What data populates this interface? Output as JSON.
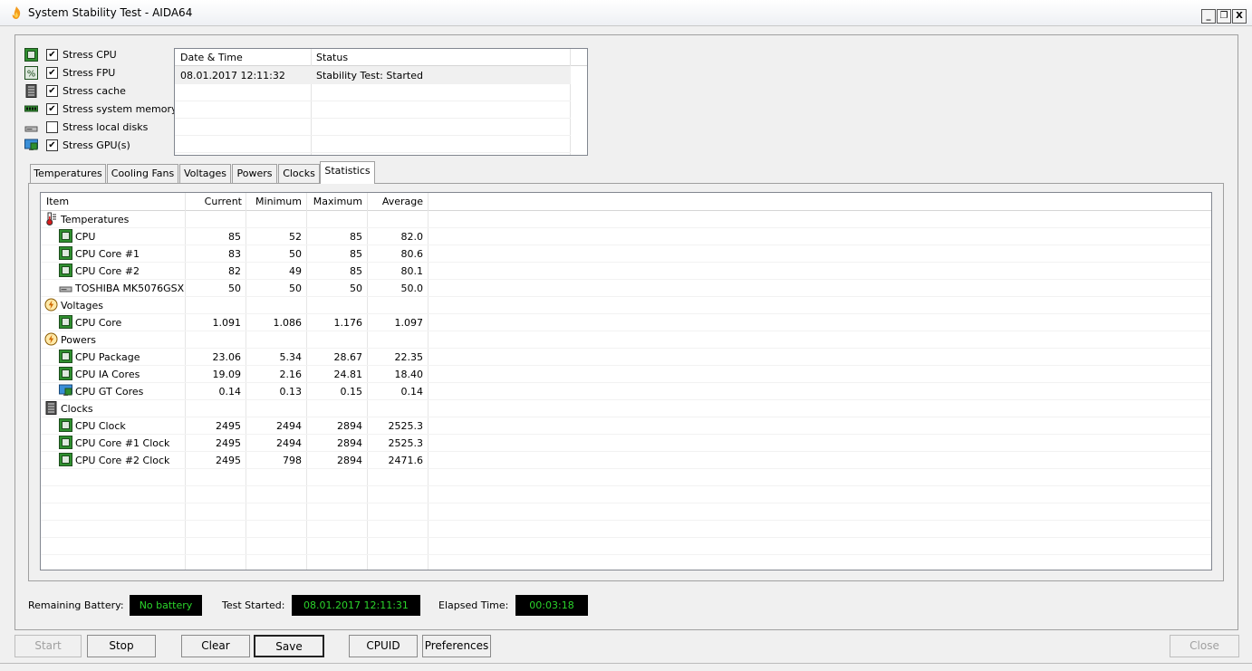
{
  "window": {
    "title": "System Stability Test - AIDA64",
    "min": "_",
    "restore": "❐",
    "close": "X"
  },
  "stress": [
    {
      "label": "Stress CPU",
      "checked": "✔",
      "icon": "cpu-chip-icon"
    },
    {
      "label": "Stress FPU",
      "checked": "✔",
      "icon": "fpu-percent-icon"
    },
    {
      "label": "Stress cache",
      "checked": "✔",
      "icon": "cache-chip-icon"
    },
    {
      "label": "Stress system memory",
      "checked": "✔",
      "icon": "memory-module-icon"
    },
    {
      "label": "Stress local disks",
      "checked": "",
      "icon": "disk-drive-icon"
    },
    {
      "label": "Stress GPU(s)",
      "checked": "✔",
      "icon": "gpu-monitor-icon"
    }
  ],
  "log": {
    "headers": [
      "Date & Time",
      "Status"
    ],
    "rows": [
      {
        "datetime": "08.01.2017 12:11:32",
        "status": "Stability Test: Started"
      }
    ]
  },
  "tabs": [
    "Temperatures",
    "Cooling Fans",
    "Voltages",
    "Powers",
    "Clocks",
    "Statistics"
  ],
  "active_tab": "Statistics",
  "stats": {
    "headers": {
      "item": "Item",
      "current": "Current",
      "minimum": "Minimum",
      "maximum": "Maximum",
      "average": "Average"
    },
    "rows": [
      {
        "group": true,
        "icon": "thermometer-icon",
        "item": "Temperatures"
      },
      {
        "icon": "cpu-chip-icon",
        "item": "CPU",
        "current": "85",
        "minimum": "52",
        "maximum": "85",
        "average": "82.0"
      },
      {
        "icon": "cpu-chip-icon",
        "item": "CPU Core #1",
        "current": "83",
        "minimum": "50",
        "maximum": "85",
        "average": "80.6"
      },
      {
        "icon": "cpu-chip-icon",
        "item": "CPU Core #2",
        "current": "82",
        "minimum": "49",
        "maximum": "85",
        "average": "80.1"
      },
      {
        "icon": "disk-drive-icon",
        "item": "TOSHIBA MK5076GSX",
        "current": "50",
        "minimum": "50",
        "maximum": "50",
        "average": "50.0"
      },
      {
        "group": true,
        "icon": "voltage-icon",
        "item": "Voltages"
      },
      {
        "icon": "cpu-chip-icon",
        "item": "CPU Core",
        "current": "1.091",
        "minimum": "1.086",
        "maximum": "1.176",
        "average": "1.097"
      },
      {
        "group": true,
        "icon": "power-icon",
        "item": "Powers"
      },
      {
        "icon": "cpu-chip-icon",
        "item": "CPU Package",
        "current": "23.06",
        "minimum": "5.34",
        "maximum": "28.67",
        "average": "22.35"
      },
      {
        "icon": "cpu-chip-icon",
        "item": "CPU IA Cores",
        "current": "19.09",
        "minimum": "2.16",
        "maximum": "24.81",
        "average": "18.40"
      },
      {
        "icon": "gpu-monitor-icon",
        "item": "CPU GT Cores",
        "current": "0.14",
        "minimum": "0.13",
        "maximum": "0.15",
        "average": "0.14"
      },
      {
        "group": true,
        "icon": "clock-chip-icon",
        "item": "Clocks"
      },
      {
        "icon": "cpu-chip-icon",
        "item": "CPU Clock",
        "current": "2495",
        "minimum": "2494",
        "maximum": "2894",
        "average": "2525.3"
      },
      {
        "icon": "cpu-chip-icon",
        "item": "CPU Core #1 Clock",
        "current": "2495",
        "minimum": "2494",
        "maximum": "2894",
        "average": "2525.3"
      },
      {
        "icon": "cpu-chip-icon",
        "item": "CPU Core #2 Clock",
        "current": "2495",
        "minimum": "798",
        "maximum": "2894",
        "average": "2471.6"
      }
    ]
  },
  "status": {
    "battery_label": "Remaining Battery:",
    "battery_value": "No battery",
    "started_label": "Test Started:",
    "started_value": "08.01.2017 12:11:31",
    "elapsed_label": "Elapsed Time:",
    "elapsed_value": "00:03:18"
  },
  "buttons": {
    "start": "Start",
    "stop": "Stop",
    "clear": "Clear",
    "save": "Save",
    "cpuid": "CPUID",
    "preferences": "Preferences",
    "close": "Close"
  },
  "colors": {
    "status_text": "#2bd42b",
    "chip_green": "#2f8f2f"
  }
}
